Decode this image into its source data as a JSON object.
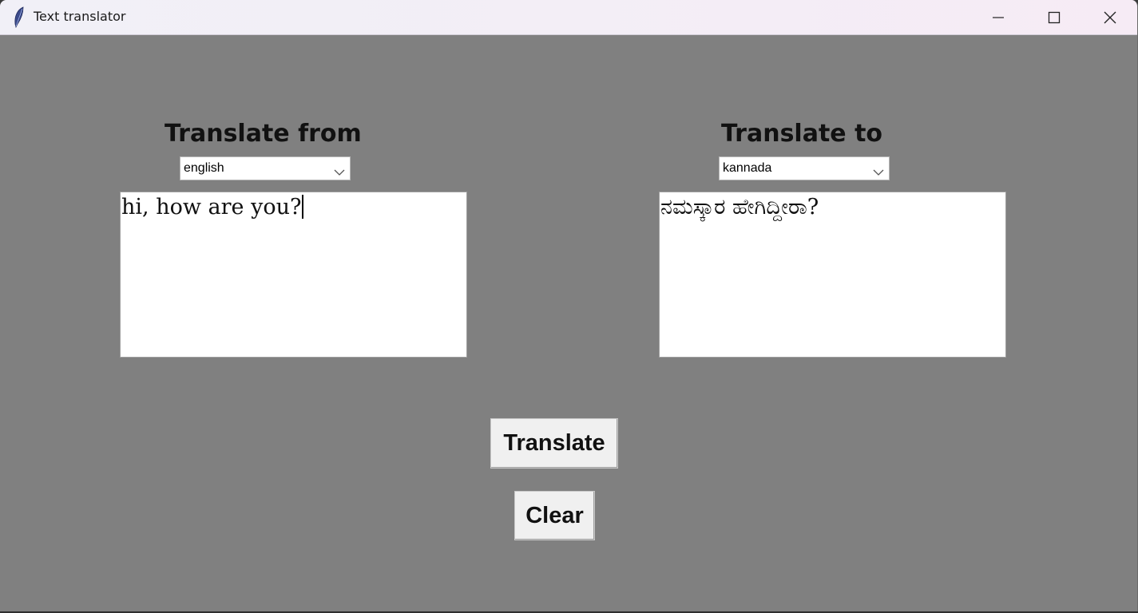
{
  "window": {
    "title": "Text translator",
    "controls": {
      "minimize_icon": "minimize-icon",
      "maximize_icon": "maximize-icon",
      "close_icon": "close-icon"
    }
  },
  "source": {
    "heading": "Translate from",
    "language": "english",
    "text": "hi, how are you?"
  },
  "target": {
    "heading": "Translate to",
    "language": "kannada",
    "text": "ನಮಸ್ಕಾರ ಹೇಗಿದ್ದೀರಾ?"
  },
  "actions": {
    "translate_label": "Translate",
    "clear_label": "Clear"
  },
  "colors": {
    "background": "#808080",
    "titlebar": "#f3eef6",
    "button": "#f0f0f0"
  }
}
